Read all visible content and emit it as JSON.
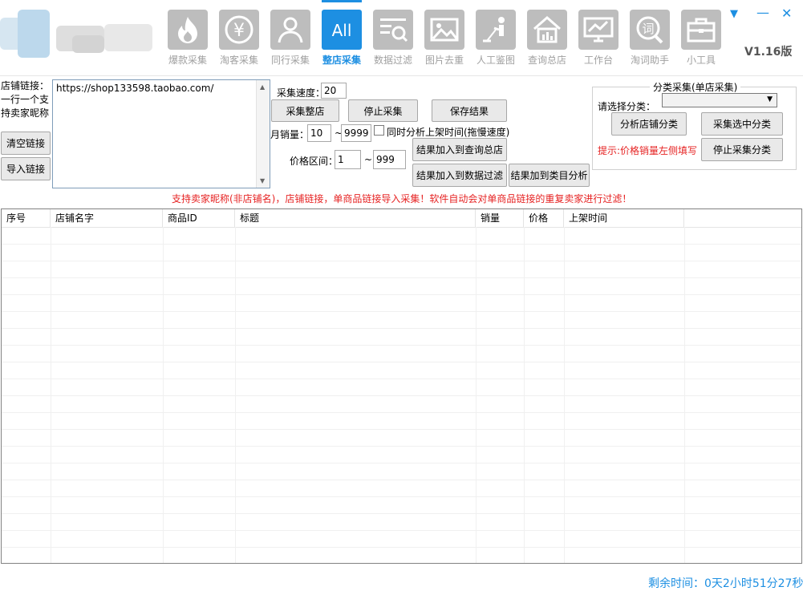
{
  "window": {
    "version": "V1.16版",
    "controls": {
      "dropdown": "▼",
      "minimize": "—",
      "close": "✕"
    }
  },
  "nav": {
    "items": [
      {
        "label": "爆款采集",
        "icon": "flame-icon"
      },
      {
        "label": "淘客采集",
        "icon": "yuan-coin-icon"
      },
      {
        "label": "同行采集",
        "icon": "person-icon"
      },
      {
        "label": "整店采集",
        "icon": "all-text-icon",
        "icon_text": "All",
        "active": true
      },
      {
        "label": "数据过滤",
        "icon": "filter-search-icon"
      },
      {
        "label": "图片去重",
        "icon": "image-icon"
      },
      {
        "label": "人工鉴图",
        "icon": "cleaner-person-icon"
      },
      {
        "label": "查询总店",
        "icon": "house-chart-icon"
      },
      {
        "label": "工作台",
        "icon": "monitor-chart-icon"
      },
      {
        "label": "淘词助手",
        "icon": "word-search-icon",
        "icon_text": "词"
      },
      {
        "label": "小工具",
        "icon": "toolbox-icon"
      }
    ]
  },
  "left": {
    "label": "店铺链接：一行一个支持卖家昵称",
    "clear_button": "清空链接",
    "import_button": "导入链接",
    "url_value": "https://shop133598.taobao.com/"
  },
  "middle": {
    "speed_label": "采集速度：",
    "speed_value": "20",
    "collect_shop_button": "采集整店",
    "stop_collect_button": "停止采集",
    "save_button": "保存结果",
    "monthly_sales_label": "月销量：",
    "sales_min": "10",
    "sales_max": "9999",
    "tilde": "~",
    "analyze_time_label": "同时分析上架时间(拖慢速度)",
    "price_label": "价格区间：",
    "price_min": "1",
    "price_max": "999",
    "add_query_button": "结果加入到查询总店",
    "add_filter_button": "结果加入到数据过滤",
    "add_category_button": "结果加到类目分析"
  },
  "category": {
    "title": "分类采集(单店采集)",
    "select_label": "请选择分类：",
    "select_value": "",
    "analyze_button": "分析店铺分类",
    "collect_selected_button": "采集选中分类",
    "stop_button": "停止采集分类",
    "hint": "提示:价格销量左侧填写"
  },
  "notice": "支持卖家昵称(非店铺名)，店铺链接，单商品链接导入采集！软件自动会对单商品链接的重复卖家进行过滤！",
  "table": {
    "columns": [
      "序号",
      "店铺名字",
      "商品ID",
      "标题",
      "销量",
      "价格",
      "上架时间"
    ],
    "rows": []
  },
  "status": {
    "remaining": "剩余时间：0天2小时51分27秒"
  },
  "colors": {
    "accent": "#1d8fe2",
    "warning": "#e62323",
    "icon_gray": "#bdbdbd"
  }
}
